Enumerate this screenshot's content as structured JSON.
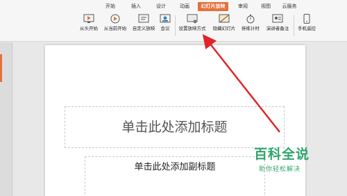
{
  "ribbon": {
    "tabs": [
      {
        "label": "开始",
        "active": false
      },
      {
        "label": "插入",
        "active": false
      },
      {
        "label": "设计",
        "active": false
      },
      {
        "label": "动画",
        "active": false
      },
      {
        "label": "幻灯片放映",
        "active": true
      },
      {
        "label": "审阅",
        "active": false
      },
      {
        "label": "视图",
        "active": false
      },
      {
        "label": "云服务",
        "active": false
      }
    ],
    "tools": [
      {
        "label": "从头开始",
        "icon": "play-from-start-icon"
      },
      {
        "label": "从当前开始",
        "icon": "play-from-current-icon"
      },
      {
        "label": "自定义放映",
        "icon": "custom-show-icon"
      },
      {
        "label": "会议",
        "icon": "meeting-icon"
      },
      {
        "label": "设置放映方式",
        "icon": "setup-show-icon"
      },
      {
        "label": "隐藏幻灯片",
        "icon": "hide-slide-icon"
      },
      {
        "label": "排练计时",
        "icon": "rehearse-timing-icon"
      },
      {
        "label": "演讲者备注",
        "icon": "speaker-notes-icon"
      },
      {
        "label": "手机遥控",
        "icon": "phone-remote-icon"
      }
    ]
  },
  "slide": {
    "title_placeholder": "单击此处添加标题",
    "subtitle_placeholder": "单击此处添加副标题"
  },
  "watermark": {
    "title": "百科全说",
    "subtitle": "助你轻松解决"
  },
  "colors": {
    "accent": "#e5703c",
    "arrow": "#e0242b",
    "watermark": "#2ea56d"
  }
}
